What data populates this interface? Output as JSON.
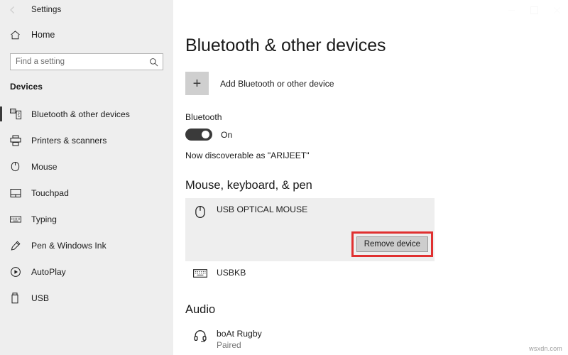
{
  "window": {
    "title": "Settings",
    "back_icon": "back-arrow-icon",
    "controls": [
      {
        "name": "minimize-button",
        "glyph": "—"
      },
      {
        "name": "maximize-button",
        "glyph": "▢"
      },
      {
        "name": "close-button",
        "glyph": "✕"
      }
    ]
  },
  "sidebar": {
    "home": {
      "label": "Home",
      "icon": "home-icon"
    },
    "search": {
      "placeholder": "Find a setting",
      "value": "",
      "icon": "search-icon"
    },
    "section_title": "Devices",
    "items": [
      {
        "label": "Bluetooth & other devices",
        "icon": "bluetooth-devices-icon",
        "selected": true
      },
      {
        "label": "Printers & scanners",
        "icon": "printer-icon",
        "selected": false
      },
      {
        "label": "Mouse",
        "icon": "mouse-icon",
        "selected": false
      },
      {
        "label": "Touchpad",
        "icon": "touchpad-icon",
        "selected": false
      },
      {
        "label": "Typing",
        "icon": "keyboard-icon",
        "selected": false
      },
      {
        "label": "Pen & Windows Ink",
        "icon": "pen-icon",
        "selected": false
      },
      {
        "label": "AutoPlay",
        "icon": "autoplay-icon",
        "selected": false
      },
      {
        "label": "USB",
        "icon": "usb-icon",
        "selected": false
      }
    ]
  },
  "main": {
    "page_title": "Bluetooth & other devices",
    "add_device": {
      "label": "Add Bluetooth or other device",
      "icon": "plus-icon"
    },
    "bluetooth": {
      "heading": "Bluetooth",
      "toggle_state": "On",
      "discoverable_text": "Now discoverable as \"ARIJEET\""
    },
    "groups": [
      {
        "heading": "Mouse, keyboard, & pen",
        "devices": [
          {
            "name": "USB OPTICAL MOUSE",
            "status": "",
            "icon": "mouse-icon",
            "selected": true,
            "action_label": "Remove device"
          },
          {
            "name": "USBKB",
            "status": "",
            "icon": "keyboard-icon",
            "selected": false,
            "action_label": ""
          }
        ]
      },
      {
        "heading": "Audio",
        "devices": [
          {
            "name": "boAt Rugby",
            "status": "Paired",
            "icon": "headset-icon",
            "selected": false,
            "action_label": ""
          }
        ]
      }
    ]
  },
  "watermark": "wsxdn.com",
  "colors": {
    "sidebar_bg": "#eeeeee",
    "content_bg": "#ffffff",
    "selected_row_bg": "#eeeeee",
    "highlight_border": "#e03030",
    "toggle_on": "#3a3a3a",
    "plus_box": "#cfcfcf",
    "button_face": "#cdcdcd"
  }
}
